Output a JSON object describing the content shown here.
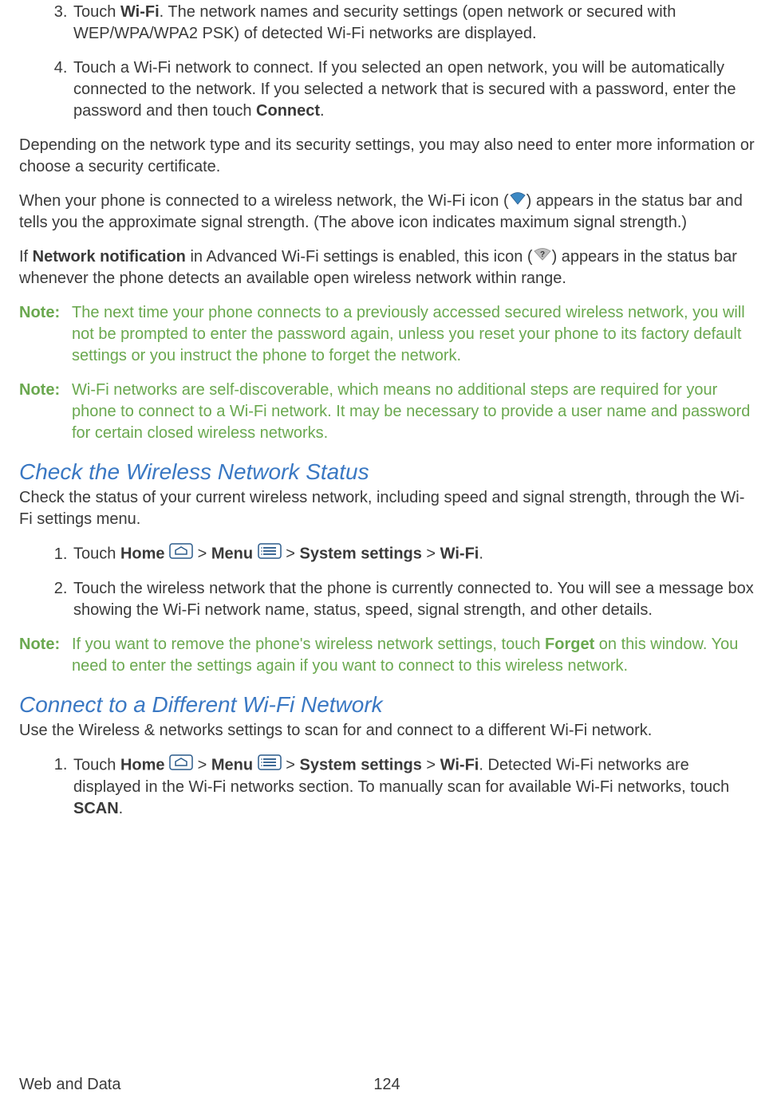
{
  "step3": {
    "num": "3.",
    "pre": "Touch ",
    "bold": "Wi-Fi",
    "post": ". The network names and security settings (open network or secured with WEP/WPA/WPA2 PSK) of detected Wi-Fi networks are displayed."
  },
  "step4": {
    "num": "4.",
    "pre": "Touch a Wi-Fi network to connect. If you selected an open network, you will be automatically connected to the network. If you selected a network that is secured with a password, enter the password and then touch ",
    "bold": "Connect",
    "post": "."
  },
  "para_depending": "Depending on the network type and its security settings, you may also need to enter more information or choose a security certificate.",
  "para_connected": {
    "pre": "When your phone is connected to a wireless network, the Wi-Fi icon (",
    "post": ") appears in the status bar and tells you the approximate signal strength. (The above icon indicates maximum signal strength.)"
  },
  "para_notification": {
    "pre1": "If ",
    "bold": "Network notification",
    "mid": " in Advanced Wi-Fi settings is enabled, this icon (",
    "post": ") appears in the status bar whenever the phone detects an available open wireless network within range."
  },
  "note1_label": "Note:",
  "note1_body": "The next time your phone connects to a previously accessed secured wireless network, you will not be prompted to enter the password again, unless you reset your phone to its factory default settings or you instruct the phone to forget the network.",
  "note2_label": "Note:",
  "note2_body": "Wi-Fi networks are self-discoverable, which means no additional steps are required for your phone to connect to a Wi-Fi network. It may be necessary to provide a user name and password for certain closed wireless networks.",
  "heading_check": "Check the Wireless Network Status",
  "para_check_intro": "Check the status of your current wireless network, including speed and signal strength, through the Wi-Fi settings menu.",
  "check_step1": {
    "num": "1.",
    "t1": "Touch ",
    "home": "Home",
    "sep1": " > ",
    "menu": "Menu",
    "sep2": " > ",
    "sys": "System settings",
    "sep3": " > ",
    "wifi": "Wi-Fi",
    "post": "."
  },
  "check_step2": {
    "num": "2.",
    "text": "Touch the wireless network that the phone is currently connected to. You will see a message box showing the Wi-Fi network name, status, speed, signal strength, and other details."
  },
  "note3_label": "Note:",
  "note3_body": {
    "pre": "If you want to remove the phone's wireless network settings, touch ",
    "bold": "Forget",
    "post": " on this window. You need to enter the settings again if you want to connect to this wireless network."
  },
  "heading_connect": "Connect to a Different Wi-Fi Network",
  "para_connect_intro": "Use the Wireless & networks settings to scan for and connect to a different Wi-Fi network.",
  "connect_step1": {
    "num": "1.",
    "t1": "Touch ",
    "home": "Home",
    "sep1": " > ",
    "menu": "Menu",
    "sep2": " > ",
    "sys": "System settings",
    "sep3": " > ",
    "wifi": "Wi-Fi",
    "mid": ". Detected Wi-Fi networks are displayed in the Wi-Fi networks section. To manually scan for available Wi-Fi networks, touch ",
    "scan": "SCAN",
    "post": "."
  },
  "footer": {
    "left": "Web and Data",
    "right": "124"
  }
}
